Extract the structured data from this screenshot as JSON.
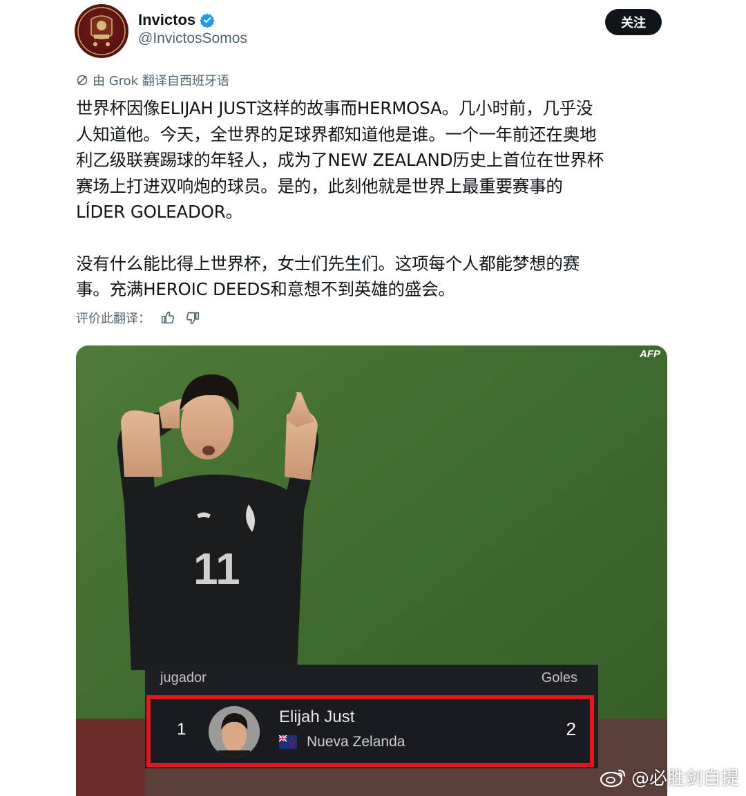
{
  "author": {
    "display_name": "Invictos",
    "handle": "@InvictosSomos",
    "verified_color": "#1d9bf0"
  },
  "follow_label": "关注",
  "translation_note": "由 Grok 翻译自西班牙语",
  "tweet": {
    "lines_p1": [
      "世界杯因像ELIJAH JUST这样的故事而HERMOSA。几小时前，几乎没",
      "人知道他。今天，全世界的足球界都知道他是谁。一个一年前还在奥地",
      "利乙级联赛踢球的年轻人，成为了NEW ZEALAND历史上首位在世界杯",
      "赛场上打进双响炮的球员。是的，此刻他就是世界上最重要赛事的",
      "LÍDER GOLEADOR。"
    ],
    "lines_p2": [
      "没有什么能比得上世界杯，女士们先生们。这项每个人都能梦想的赛",
      "事。充满HEROIC DEEDS和意想不到英雄的盛会。"
    ]
  },
  "rate_label": "评价此翻译：",
  "media": {
    "afp_label": "AFP",
    "jersey_number": "11",
    "scoreboard": {
      "col_player": "jugador",
      "col_goals": "Goles",
      "rank": "1",
      "player_name": "Elijah Just",
      "country": "Nueva Zelanda",
      "goals": "2",
      "highlight_color": "#e0181b"
    }
  },
  "watermark": "@必胜剑自提",
  "icons": [
    "verified-icon",
    "grok-icon",
    "thumbs-up-icon",
    "thumbs-down-icon",
    "flag-icon",
    "weibo-icon"
  ]
}
